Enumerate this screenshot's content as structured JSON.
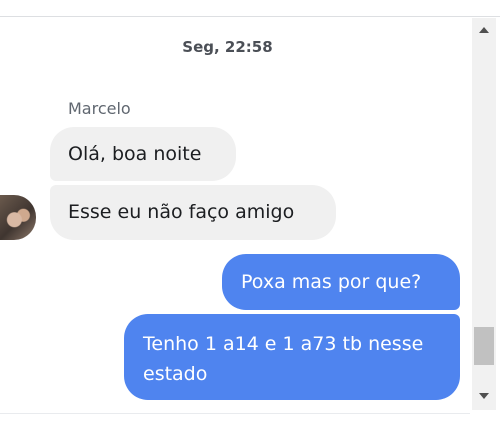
{
  "conversation": {
    "timestamp": "Seg, 22:58",
    "sender_name": "Marcelo",
    "avatar_icon": "user-avatar-photo",
    "messages": [
      {
        "direction": "incoming",
        "text": "Olá, boa noite"
      },
      {
        "direction": "incoming",
        "text": "Esse eu não faço amigo"
      },
      {
        "direction": "outgoing",
        "text": "Poxa mas por que?"
      },
      {
        "direction": "outgoing",
        "text": "Tenho 1 a14 e 1 a73 tb nesse estado"
      }
    ]
  },
  "scrollbar": {
    "up_icon": "chevron-up-icon",
    "down_icon": "chevron-down-icon"
  },
  "colors": {
    "outgoing_bubble": "#4f84ef",
    "incoming_bubble": "#f0f0f0",
    "timestamp_text": "#4b4f56",
    "sender_text": "#606770"
  }
}
